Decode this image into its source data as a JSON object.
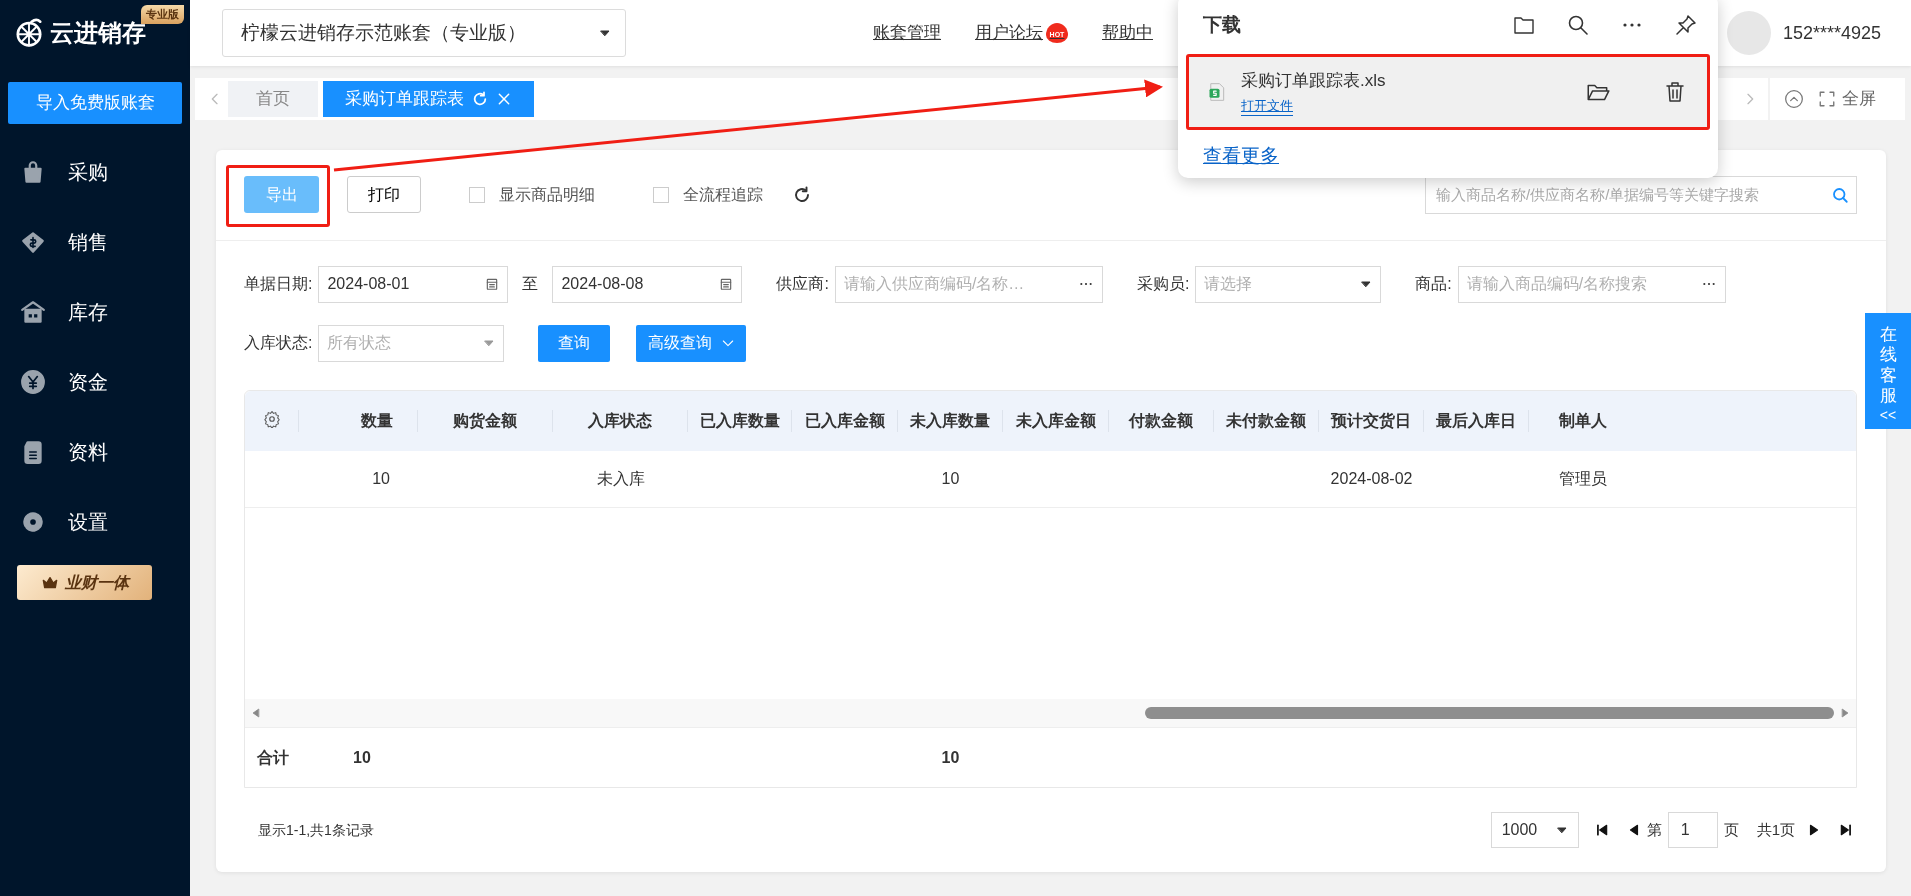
{
  "sidebar": {
    "logo": "云进销存",
    "edition_badge": "专业版",
    "import_button": "导入免费版账套",
    "items": [
      {
        "label": "采购"
      },
      {
        "label": "销售"
      },
      {
        "label": "库存"
      },
      {
        "label": "资金"
      },
      {
        "label": "资料"
      },
      {
        "label": "设置"
      }
    ],
    "promo_badge": "业财一体"
  },
  "header": {
    "account_select": "柠檬云进销存示范账套（专业版）",
    "links": [
      {
        "label": "账套管理",
        "hot": false
      },
      {
        "label": "用户论坛",
        "hot": true,
        "hot_badge": "HOT"
      },
      {
        "label": "帮助中",
        "hot": false
      }
    ],
    "user": "152****4925"
  },
  "tabs": [
    {
      "label": "首页",
      "selected": false
    },
    {
      "label": "采购订单跟踪表",
      "selected": true
    }
  ],
  "fullscreen": "全屏",
  "toolbar": {
    "buttons": [
      "导出",
      "打印"
    ],
    "checkboxes": [
      {
        "label": "显示商品明细",
        "checked": false
      },
      {
        "label": "全流程追踪",
        "checked": false
      }
    ],
    "search": {
      "placeholder": "输入商品名称/供应商名称/单据编号等关键字搜索"
    }
  },
  "filter_rows": [
    {
      "fields": [
        {
          "kind": "date_range",
          "label": "单据日期:",
          "from": "2024-08-01",
          "separator": "至",
          "to": "2024-08-08"
        },
        {
          "kind": "picker",
          "label": "供应商:",
          "placeholder": "请输入供应商编码/名称…"
        },
        {
          "kind": "select",
          "label": "采购员:",
          "placeholder": "请选择"
        },
        {
          "kind": "picker",
          "label": "商品:",
          "placeholder": "请输入商品编码/名称搜索"
        }
      ]
    },
    {
      "fields": [
        {
          "kind": "select",
          "label": "入库状态:",
          "placeholder": "所有状态"
        }
      ],
      "buttons": [
        "查询",
        "高级查询"
      ]
    }
  ],
  "table": {
    "columns": [
      "数量",
      "购货金额",
      "入库状态",
      "已入库数量",
      "已入库金额",
      "未入库数量",
      "未入库金额",
      "付款金额",
      "未付款金额",
      "预计交货日",
      "最后入库日",
      "制单人"
    ],
    "rows": [
      [
        "10",
        null,
        "未入库",
        null,
        null,
        "10",
        null,
        null,
        null,
        "2024-08-02",
        null,
        "管理员"
      ]
    ],
    "totals": {
      "label": "合计",
      "cells": [
        "10",
        null,
        null,
        null,
        null,
        "10",
        null,
        null,
        null,
        null,
        null,
        null
      ]
    }
  },
  "pagination": {
    "summary": "显示1-1,共1条记录",
    "page_size": "1000",
    "page_prefix": "第",
    "page": "1",
    "page_suffix": "页",
    "total_pages": "共1页"
  },
  "download_panel": {
    "title": "下载",
    "file": {
      "name": "采购订单跟踪表.xls",
      "action": "打开文件"
    },
    "more_link": "查看更多"
  },
  "chat_tab": {
    "label": "在线客服",
    "arrow": "<<"
  }
}
